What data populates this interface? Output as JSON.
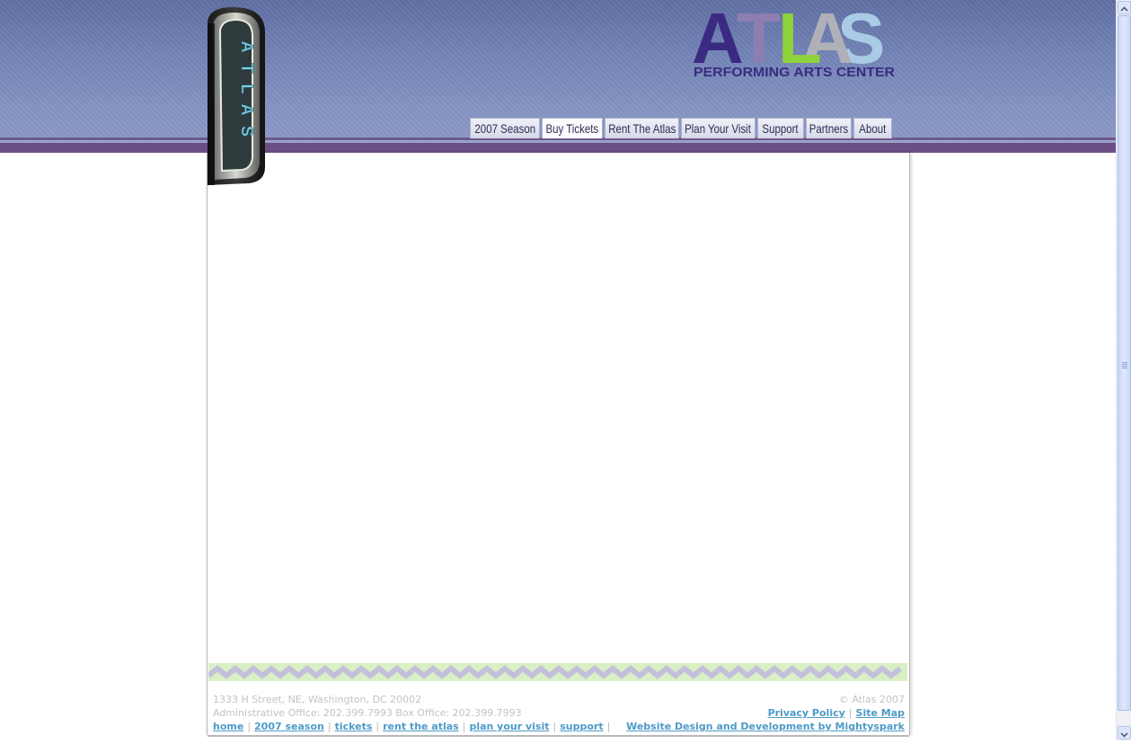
{
  "logo": {
    "letters": [
      "A",
      "T",
      "L",
      "A",
      "S"
    ],
    "letter_colors": [
      "#3b2a82",
      "#8c7fb0",
      "#8fd33b",
      "#b0b0b8",
      "#a9cbe6"
    ],
    "subtitle": "PERFORMING ARTS CENTER",
    "subtitle_color": "#3b2a82"
  },
  "sign": {
    "letters": [
      "A",
      "T",
      "L",
      "A",
      "S"
    ]
  },
  "nav": {
    "items": [
      {
        "label": "2007 Season"
      },
      {
        "label": "Buy Tickets",
        "active": true
      },
      {
        "label": "Rent The Atlas"
      },
      {
        "label": "Plan Your Visit"
      },
      {
        "label": "Support"
      },
      {
        "label": "Partners"
      },
      {
        "label": "About"
      }
    ]
  },
  "footer": {
    "address": "1333 H Street, NE, Washington, DC 20002",
    "phones": "Administrative Office: 202.399.7993 Box Office: 202.399.7993",
    "links": [
      "home",
      "2007 season",
      "tickets",
      "rent the atlas",
      "plan your visit",
      "support"
    ],
    "copyright": "© Atlas 2007",
    "privacy": "Privacy Policy",
    "sitemap": "Site Map",
    "credit": "Website Design and Development by Mightyspark"
  },
  "colors": {
    "header_top": "#5f6fa3",
    "header_band": "#6b4e86",
    "link": "#4e9ac8",
    "footer_text": "#c3c3c3",
    "zigzag_bg": "#d9f0c4",
    "zigzag_fg": "#c3c0dc"
  },
  "icons": [
    "scroll-up-arrow-icon",
    "scroll-down-arrow-icon"
  ]
}
